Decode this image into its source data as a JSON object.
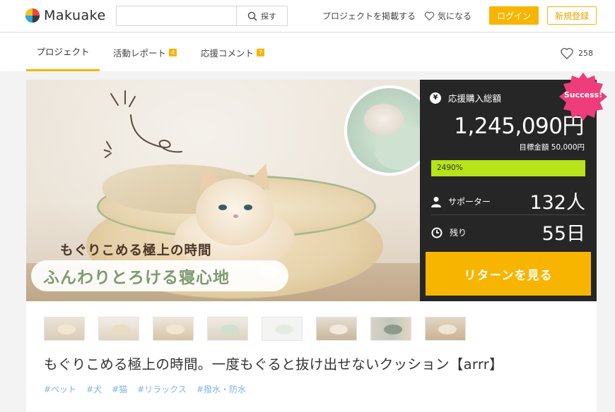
{
  "header": {
    "logo_text": "Makuake",
    "search": {
      "value": "",
      "placeholder": "",
      "button_label": "探す"
    },
    "links": {
      "post_project": "プロジェクトを掲載する",
      "favorites": "気になる"
    },
    "login_label": "ログイン",
    "signup_label": "新規登録"
  },
  "tabs": [
    {
      "label": "プロジェクト",
      "active": true
    },
    {
      "label": "活動レポート",
      "badge": "4"
    },
    {
      "label": "応援コメント",
      "badge": "7"
    }
  ],
  "likes_count": "258",
  "hero": {
    "copy_line1": "もぐりこめる極上の時間",
    "copy_line2": "ふんわりとろける寝心地"
  },
  "funding": {
    "total_label": "応援購入総額",
    "amount": "1,245,090円",
    "goal": "目標金額 50,000円",
    "progress_text": "2490%",
    "progress_fraction": 1.0,
    "supporters_label": "サポーター",
    "supporters_value": "132人",
    "remaining_label": "残り",
    "remaining_value": "55日",
    "return_button": "リターンを見る",
    "badge": "Success!",
    "accent": "#f8b500",
    "progress_color": "#b6e319",
    "badge_color": "#ee3d7a"
  },
  "thumbnails": 8,
  "project": {
    "title": "もぐりこめる極上の時間。一度もぐると抜け出せないクッション【arrr】",
    "tags": [
      "#ペット",
      "#犬",
      "#猫",
      "#リラックス",
      "#撥水・防水"
    ]
  }
}
